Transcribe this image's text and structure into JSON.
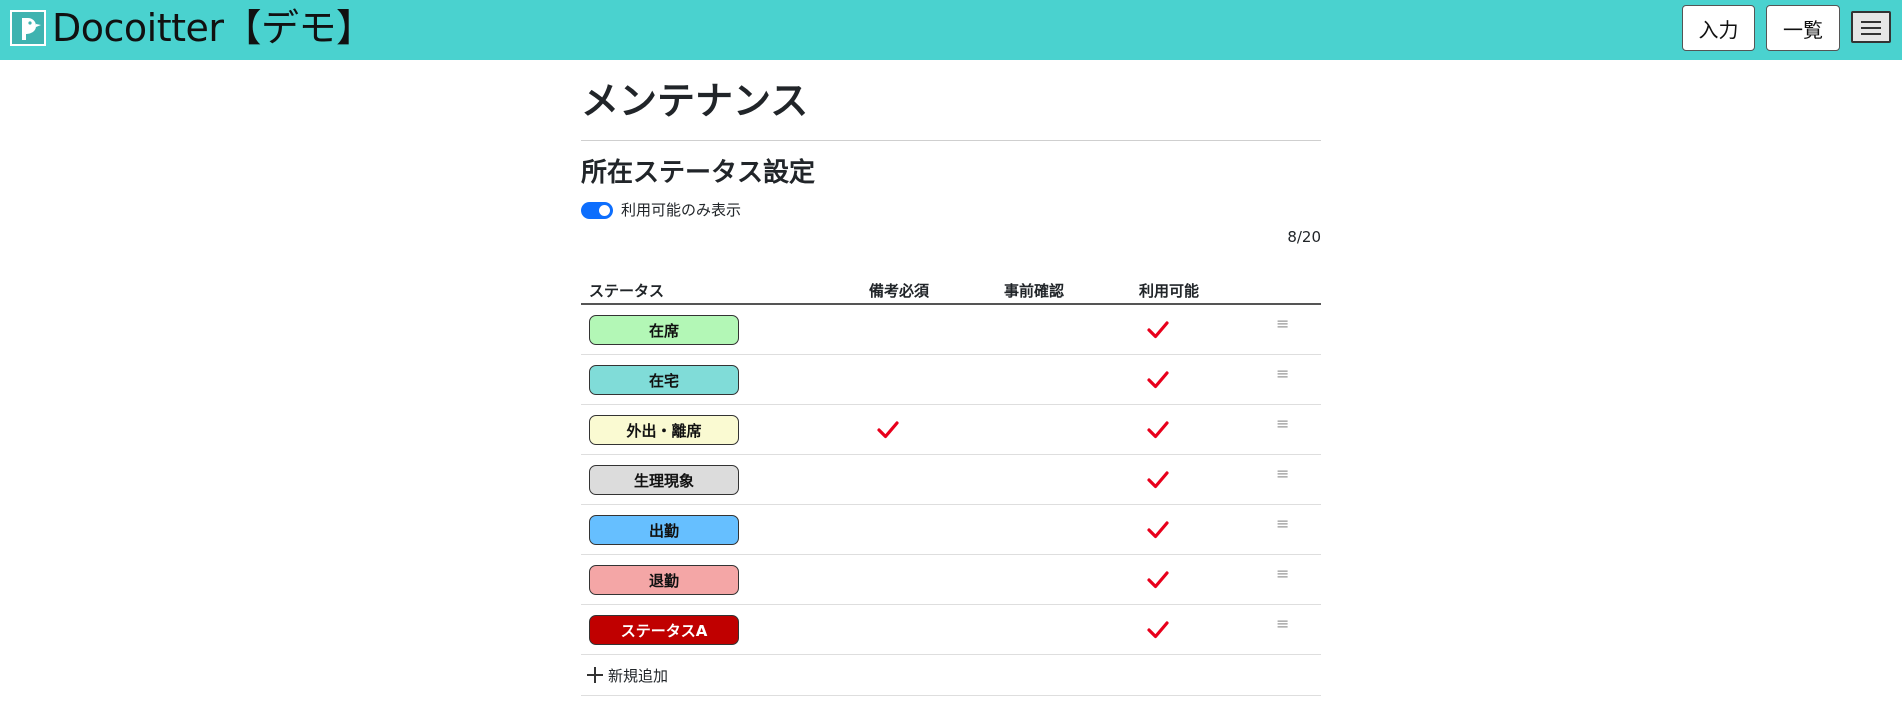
{
  "header": {
    "brand": "Docoitter【デモ】",
    "input_button": "入力",
    "list_button": "一覧"
  },
  "page": {
    "title": "メンテナンス",
    "section_title": "所在ステータス設定",
    "toggle_label": "利用可能のみ表示",
    "toggle_on": true,
    "count": "8/20"
  },
  "table": {
    "headers": [
      "ステータス",
      "備考必須",
      "事前確認",
      "利用可能"
    ],
    "rows": [
      {
        "label": "在席",
        "bg": "#b3f7b6",
        "fg": "#111111",
        "remarks_required": false,
        "pre_confirm": false,
        "available": true
      },
      {
        "label": "在宅",
        "bg": "#80dcd8",
        "fg": "#111111",
        "remarks_required": false,
        "pre_confirm": false,
        "available": true
      },
      {
        "label": "外出・離席",
        "bg": "#fafad2",
        "fg": "#111111",
        "remarks_required": true,
        "pre_confirm": false,
        "available": true
      },
      {
        "label": "生理現象",
        "bg": "#dcdcdc",
        "fg": "#111111",
        "remarks_required": false,
        "pre_confirm": false,
        "available": true
      },
      {
        "label": "出勤",
        "bg": "#66bfff",
        "fg": "#111111",
        "remarks_required": false,
        "pre_confirm": false,
        "available": true
      },
      {
        "label": "退勤",
        "bg": "#f4a6a6",
        "fg": "#111111",
        "remarks_required": false,
        "pre_confirm": false,
        "available": true
      },
      {
        "label": "ステータスA",
        "bg": "#c00000",
        "fg": "#ffffff",
        "remarks_required": false,
        "pre_confirm": false,
        "available": true
      }
    ],
    "add_label": "新規追加"
  },
  "colors": {
    "header_bg": "#4ad2cf",
    "check": "#e8001c",
    "toggle": "#0d6efd"
  },
  "icons": {
    "logo": "bird-logo-icon",
    "menu": "hamburger-menu-icon",
    "check": "checkmark-icon",
    "drag": "drag-handle-icon",
    "add": "plus-icon"
  }
}
